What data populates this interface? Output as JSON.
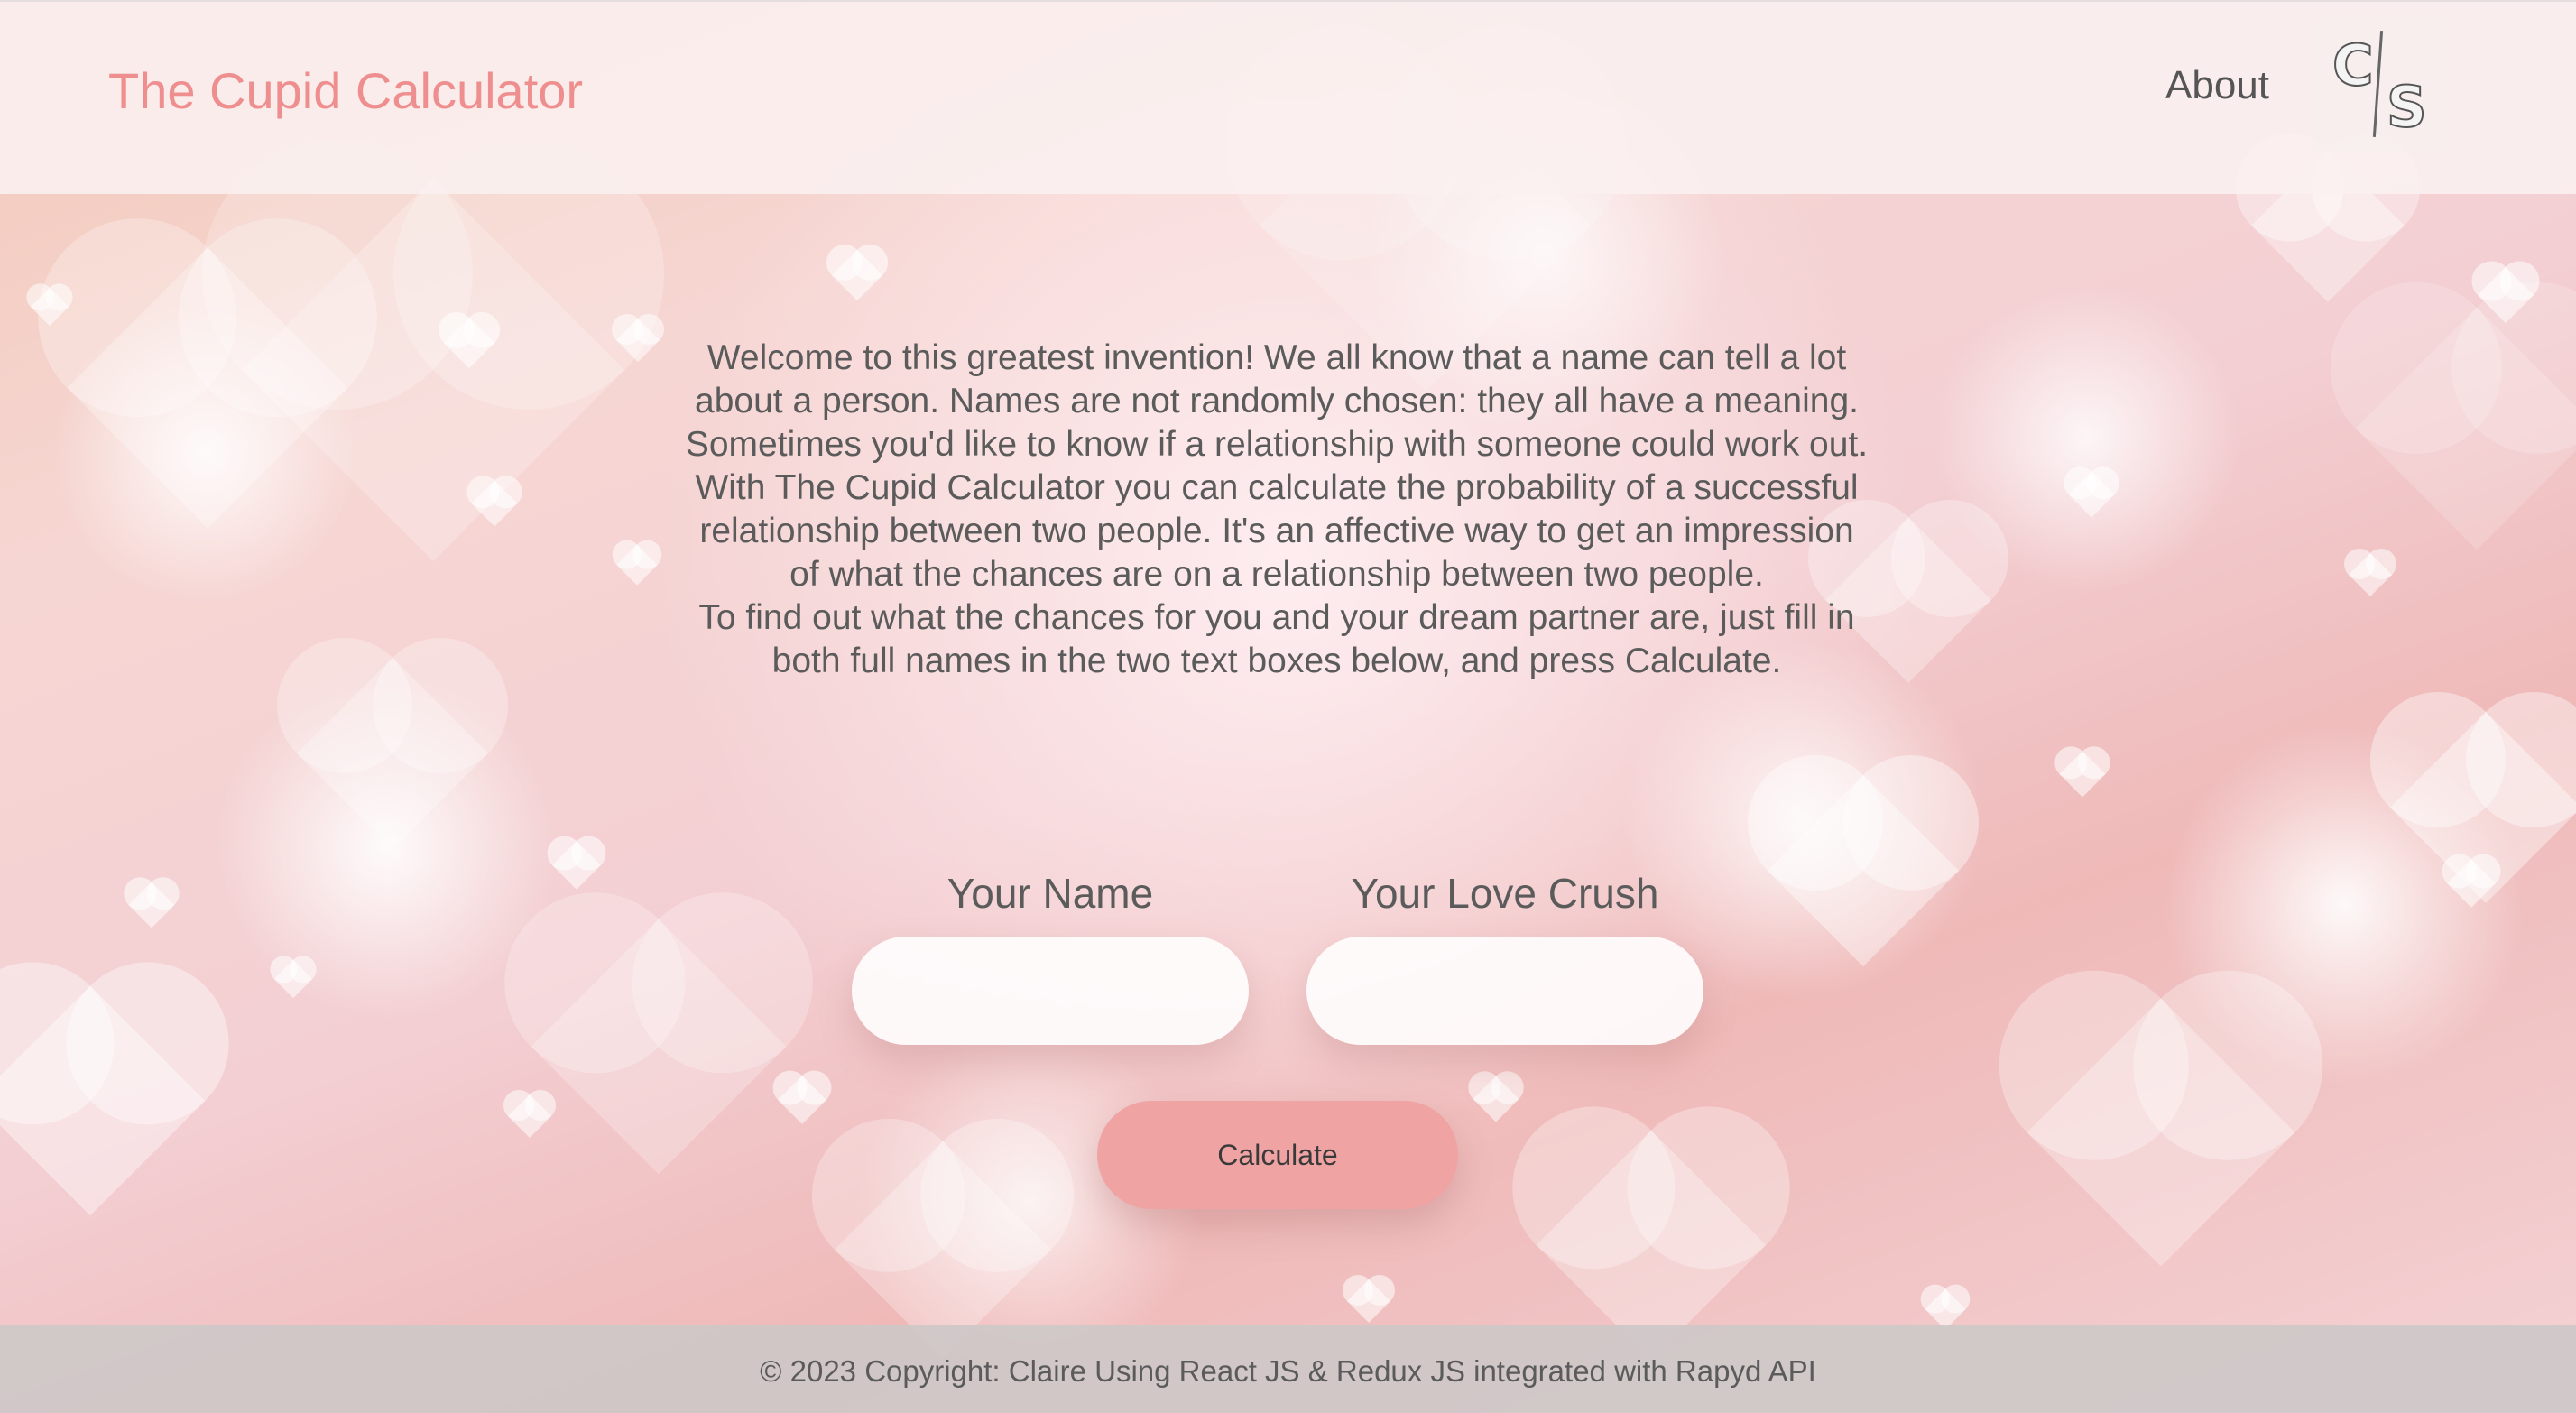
{
  "navbar": {
    "brand": "The Cupid Calculator",
    "about_link": "About",
    "logo": {
      "left_letter": "C",
      "right_letter": "S"
    }
  },
  "main": {
    "intro_paragraph_1": "Welcome to this greatest invention! We all know that a name can tell a lot about a person. Names are not randomly chosen: they all have a meaning. Sometimes you'd like to know if a relationship with someone could work out. With The Cupid Calculator you can calculate the probability of a successful relationship between two people. It's an affective way to get an impression of what the chances are on a relationship between two people.",
    "intro_paragraph_2": "To find out what the chances for you and your dream partner are, just fill in both full names in the two text boxes below, and press Calculate.",
    "form": {
      "your_name_label": "Your Name",
      "your_name_value": "",
      "love_crush_label": "Your Love Crush",
      "love_crush_value": "",
      "calculate_label": "Calculate"
    }
  },
  "footer": {
    "copyright": "© 2023 Copyright: Claire Using React JS & Redux JS integrated with Rapyd API"
  },
  "colors": {
    "brand": "#ef8e8e",
    "button": "#efa3a3",
    "text": "#5b5b5b",
    "footer_bg": "#cdc8c8"
  }
}
